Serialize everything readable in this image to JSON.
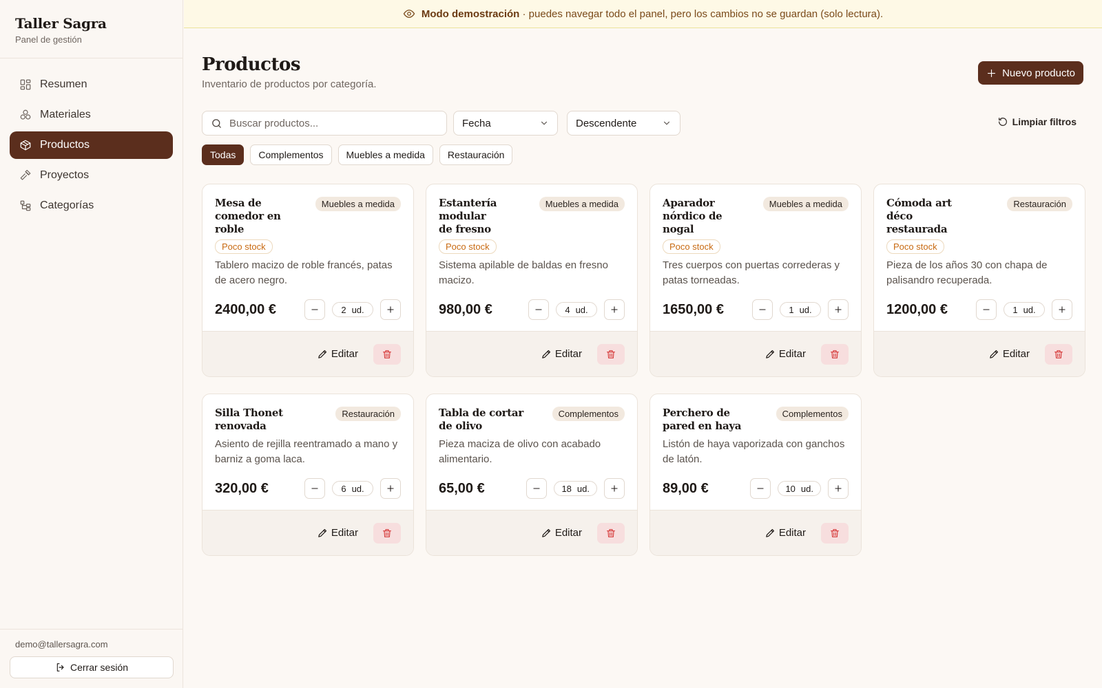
{
  "sidebar": {
    "brand_title": "Taller Sagra",
    "brand_subtitle": "Panel de gestión",
    "items": [
      {
        "label": "Resumen",
        "icon": "dashboard-icon"
      },
      {
        "label": "Materiales",
        "icon": "materials-icon"
      },
      {
        "label": "Productos",
        "icon": "box-icon",
        "active": true
      },
      {
        "label": "Proyectos",
        "icon": "hammer-icon"
      },
      {
        "label": "Categorías",
        "icon": "tree-icon"
      }
    ],
    "user_email": "demo@tallersagra.com",
    "logout_label": "Cerrar sesión"
  },
  "banner": {
    "bold": "Modo demostración",
    "text": " · puedes navegar todo el panel, pero los cambios no se guardan (solo lectura)."
  },
  "header": {
    "title": "Productos",
    "subtitle": "Inventario de productos por categoría.",
    "new_button": "Nuevo producto"
  },
  "filters": {
    "search_placeholder": "Buscar productos...",
    "sort_field": "Fecha",
    "sort_order": "Descendente",
    "clear_label": "Limpiar filtros",
    "chips": [
      "Todas",
      "Complementos",
      "Muebles a medida",
      "Restauración"
    ],
    "active_chip": "Todas"
  },
  "card_labels": {
    "low_stock": "Poco stock",
    "edit": "Editar",
    "unit": "ud."
  },
  "products": [
    {
      "name": "Mesa de comedor en roble",
      "category": "Muebles a medida",
      "low_stock": true,
      "description": "Tablero macizo de roble francés, patas de acero negro.",
      "price": "2400,00 €",
      "qty": "2"
    },
    {
      "name": "Estantería modular de fresno",
      "category": "Muebles a medida",
      "low_stock": true,
      "description": "Sistema apilable de baldas en fresno macizo.",
      "price": "980,00 €",
      "qty": "4"
    },
    {
      "name": "Aparador nórdico de nogal",
      "category": "Muebles a medida",
      "low_stock": true,
      "description": "Tres cuerpos con puertas correderas y patas torneadas.",
      "price": "1650,00 €",
      "qty": "1"
    },
    {
      "name": "Cómoda art déco restaurada",
      "category": "Restauración",
      "low_stock": true,
      "description": "Pieza de los años 30 con chapa de palisandro recuperada.",
      "price": "1200,00 €",
      "qty": "1"
    },
    {
      "name": "Silla Thonet renovada",
      "category": "Restauración",
      "low_stock": false,
      "description": "Asiento de rejilla reentramado a mano y barniz a goma laca.",
      "price": "320,00 €",
      "qty": "6"
    },
    {
      "name": "Tabla de cortar de olivo",
      "category": "Complementos",
      "low_stock": false,
      "description": "Pieza maciza de olivo con acabado alimentario.",
      "price": "65,00 €",
      "qty": "18"
    },
    {
      "name": "Perchero de pared en haya",
      "category": "Complementos",
      "low_stock": false,
      "description": "Listón de haya vaporizada con ganchos de latón.",
      "price": "89,00 €",
      "qty": "10"
    }
  ]
}
